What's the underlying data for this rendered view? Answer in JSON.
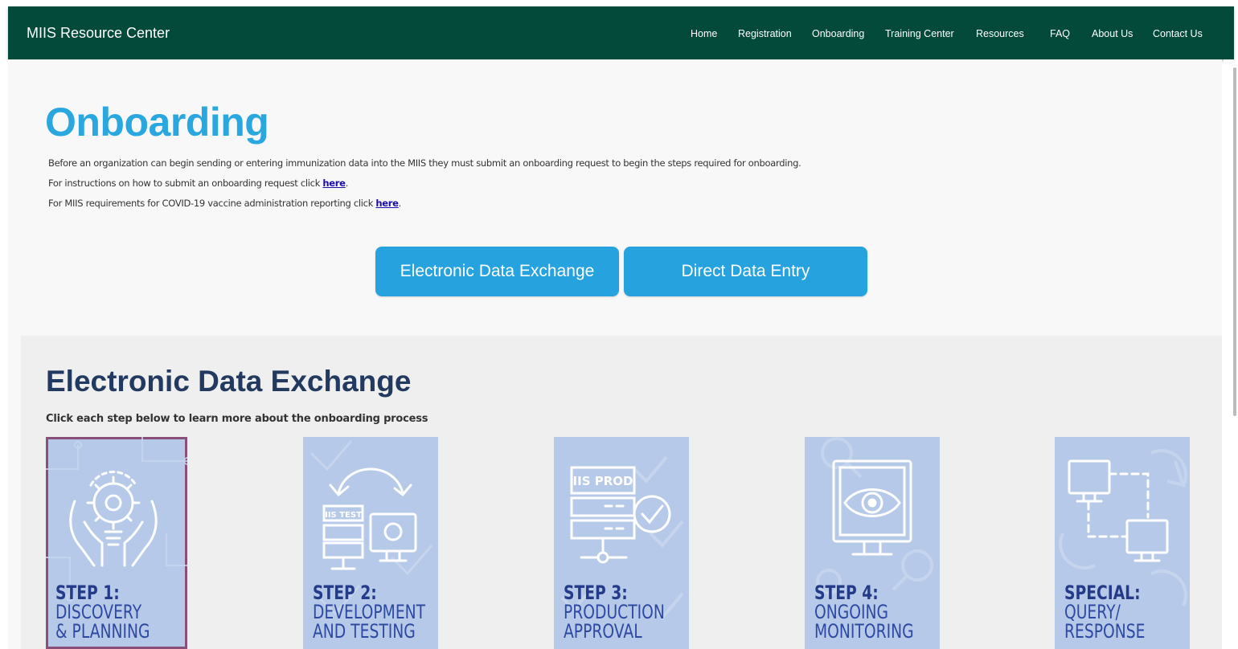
{
  "navbar": {
    "brand": "MIIS Resource Center",
    "links": [
      "Home",
      "Registration",
      "Onboarding",
      "Training Center",
      "Resources",
      "FAQ",
      "About Us",
      "Contact Us"
    ]
  },
  "header": {
    "title": "Onboarding",
    "intro_line1": "Before an organization can begin sending or entering immunization data into the MIIS they must submit an onboarding request to begin the steps required for onboarding.",
    "intro_line2_text": "For instructions on how to submit an onboarding request click ",
    "intro_line2_link": "here",
    "intro_line3_text": "For MIIS requirements for COVID-19 vaccine administration reporting click ",
    "intro_line3_link": "here",
    "period": "."
  },
  "buttons": {
    "electronic": "Electronic Data Exchange",
    "direct": "Direct Data Entry"
  },
  "section": {
    "title": "Electronic Data Exchange",
    "subtitle": "Click each step below to learn more about the onboarding process"
  },
  "steps": [
    {
      "num": "STEP 1:",
      "line1": "DISCOVERY",
      "line2": "& PLANNING",
      "icon": "lightbulb-hands-icon"
    },
    {
      "num": "STEP 2:",
      "line1": "DEVELOPMENT",
      "line2": "AND TESTING",
      "icon": "test-server-icon",
      "icon_text": "IIS TEST"
    },
    {
      "num": "STEP 3:",
      "line1": "PRODUCTION",
      "line2": "APPROVAL",
      "icon": "prod-server-check-icon",
      "icon_text": "IIS PROD"
    },
    {
      "num": "STEP 4:",
      "line1": "ONGOING",
      "line2": "MONITORING",
      "icon": "monitor-eye-icon"
    },
    {
      "num": "SPECIAL:",
      "line1": "QUERY/",
      "line2": "RESPONSE",
      "icon": "two-monitors-icon"
    }
  ],
  "colors": {
    "navbar": "#044a3a",
    "title": "#2aa7df",
    "button": "#26a3df",
    "section_title": "#233a60",
    "card": "#b7c9e8",
    "card_text": "#243b8a"
  }
}
